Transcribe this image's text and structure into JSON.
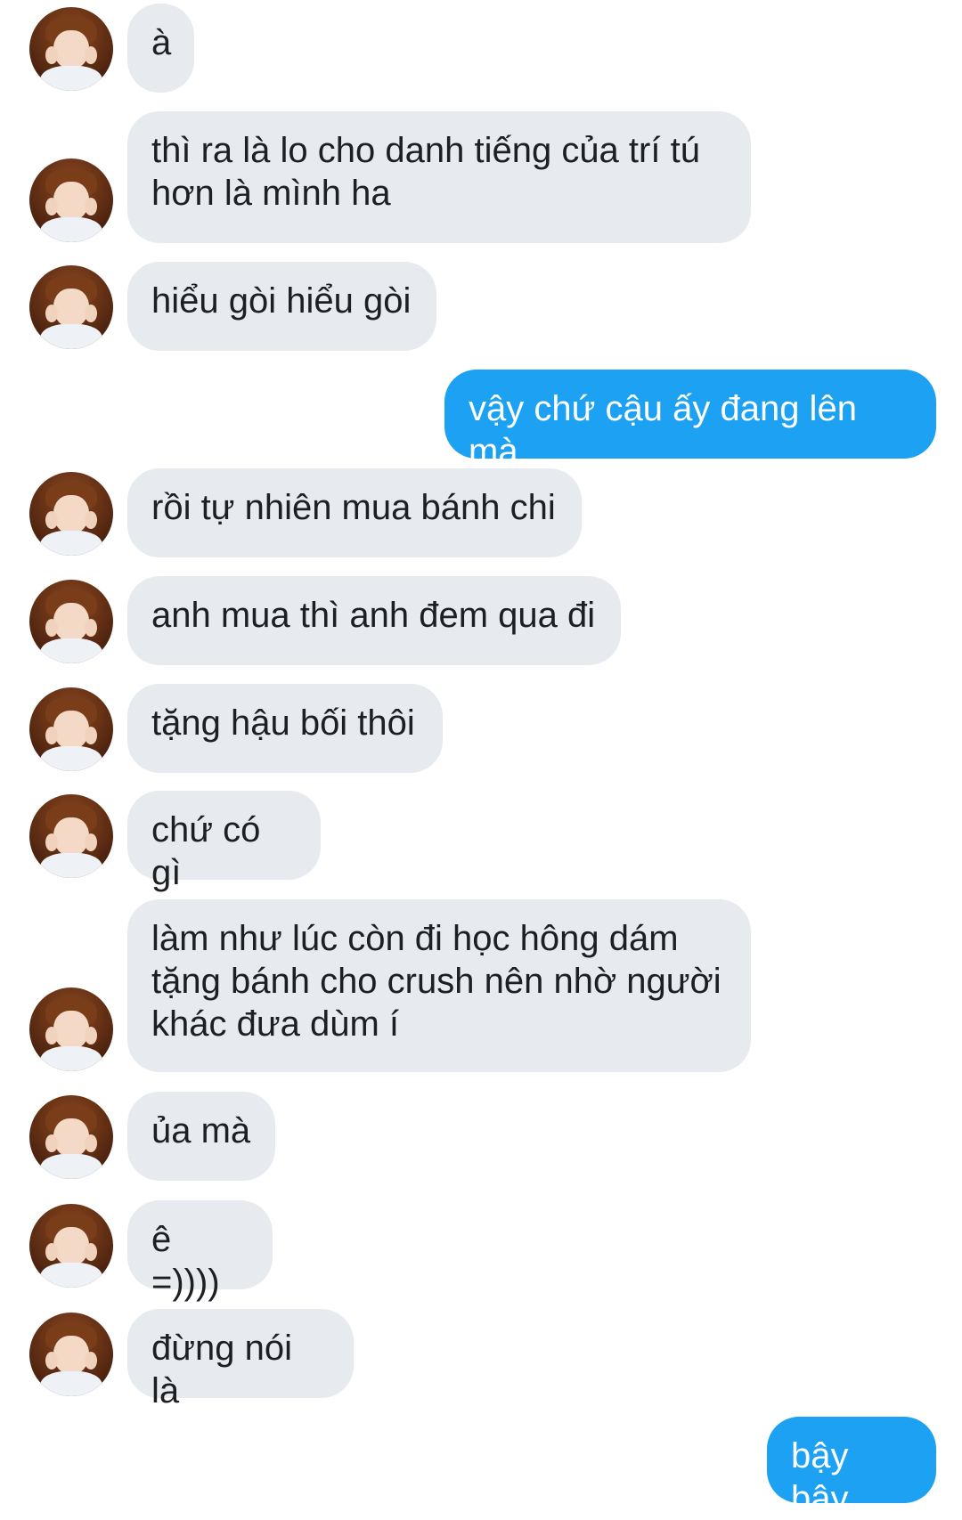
{
  "conversation": {
    "incoming_color": "#e7ebef",
    "outgoing_color": "#1da1f2",
    "messages": [
      {
        "side": "incoming",
        "text": "à"
      },
      {
        "side": "incoming",
        "text": "thì ra là lo cho danh tiếng của trí tú\nhơn là mình ha"
      },
      {
        "side": "incoming",
        "text": "hiểu gòi hiểu gòi"
      },
      {
        "side": "outgoing",
        "text": "vậy chứ cậu ấy đang lên mà"
      },
      {
        "side": "incoming",
        "text": "rồi tự nhiên mua bánh chi"
      },
      {
        "side": "incoming",
        "text": "anh mua thì anh đem qua đi"
      },
      {
        "side": "incoming",
        "text": "tặng hậu bối thôi"
      },
      {
        "side": "incoming",
        "text": "chứ có gì"
      },
      {
        "side": "incoming",
        "text": "làm như lúc còn đi học hông dám\ntặng bánh cho crush nên nhờ người\nkhác đưa dùm í"
      },
      {
        "side": "incoming",
        "text": "ủa mà"
      },
      {
        "side": "incoming",
        "text": "ê =))))"
      },
      {
        "side": "incoming",
        "text": "đừng nói là"
      },
      {
        "side": "outgoing",
        "text": "bậy bậy"
      }
    ]
  }
}
